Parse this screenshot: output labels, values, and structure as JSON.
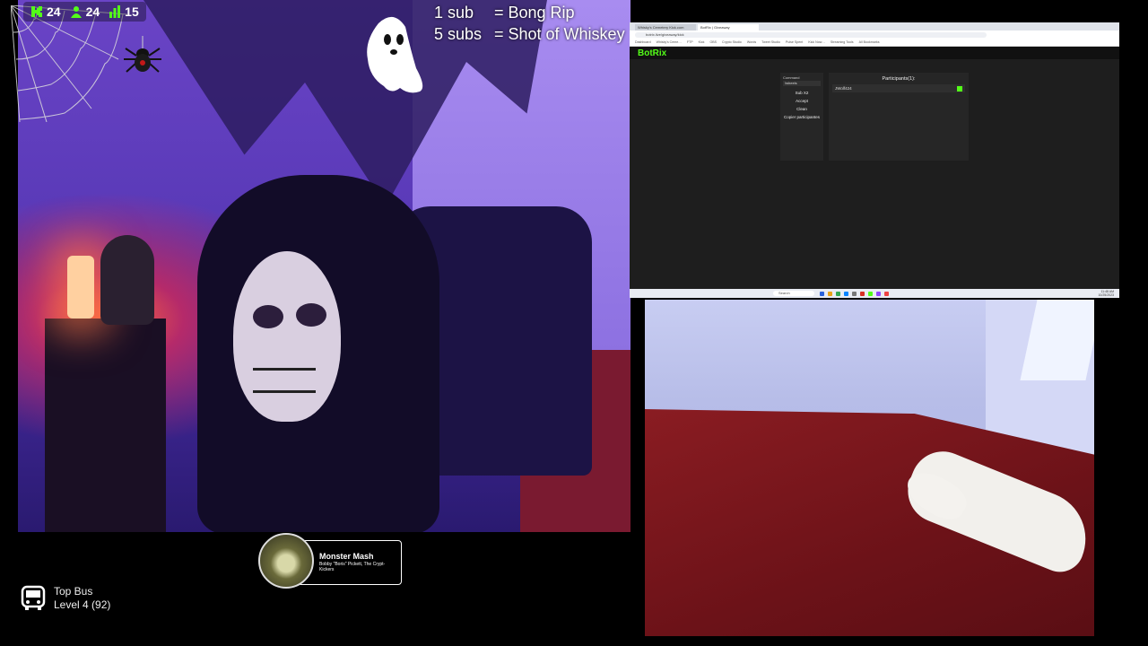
{
  "stats": {
    "followers": "24",
    "subs": "24",
    "viewers": "15"
  },
  "sub_rules": [
    {
      "count": "1 sub",
      "reward": "= Bong Rip"
    },
    {
      "count": "5 subs",
      "reward": "= Shot of Whiskey"
    }
  ],
  "browser": {
    "tabs": [
      "Whisky's Cemetery Kick.com",
      "BotRix | Giveaway"
    ],
    "url": "botrix.live/giveaway/kick",
    "bookmarks": [
      "Dashboard",
      "Whisky's Ceme…",
      "FTP",
      "Kick",
      "OBS",
      "Crypto Studio",
      "Words",
      "Tweet Studio",
      "Pulse Spent",
      "Kick Now…",
      "Streaming Tools",
      "All Bookmarks"
    ],
    "logo": "BotRix",
    "command_label": "Command",
    "command_value": "!wheels",
    "menu": [
      "Sub X2",
      "Accept",
      "Clean",
      "Copier participantes"
    ],
    "participants_title": "Participants(1):",
    "participants": [
      "JWolf424"
    ],
    "search": "Search",
    "clock": [
      "11:48 AM",
      "10/25/2023"
    ]
  },
  "now_playing": {
    "title": "Monster Mash",
    "artist": "Bobby \"Boris\" Pickett, The Crypt-Kickers"
  },
  "top_bus": {
    "title": "Top Bus",
    "level": "Level 4  (92)"
  },
  "colors": {
    "kick_green": "#53fc18",
    "background": "#000000"
  }
}
